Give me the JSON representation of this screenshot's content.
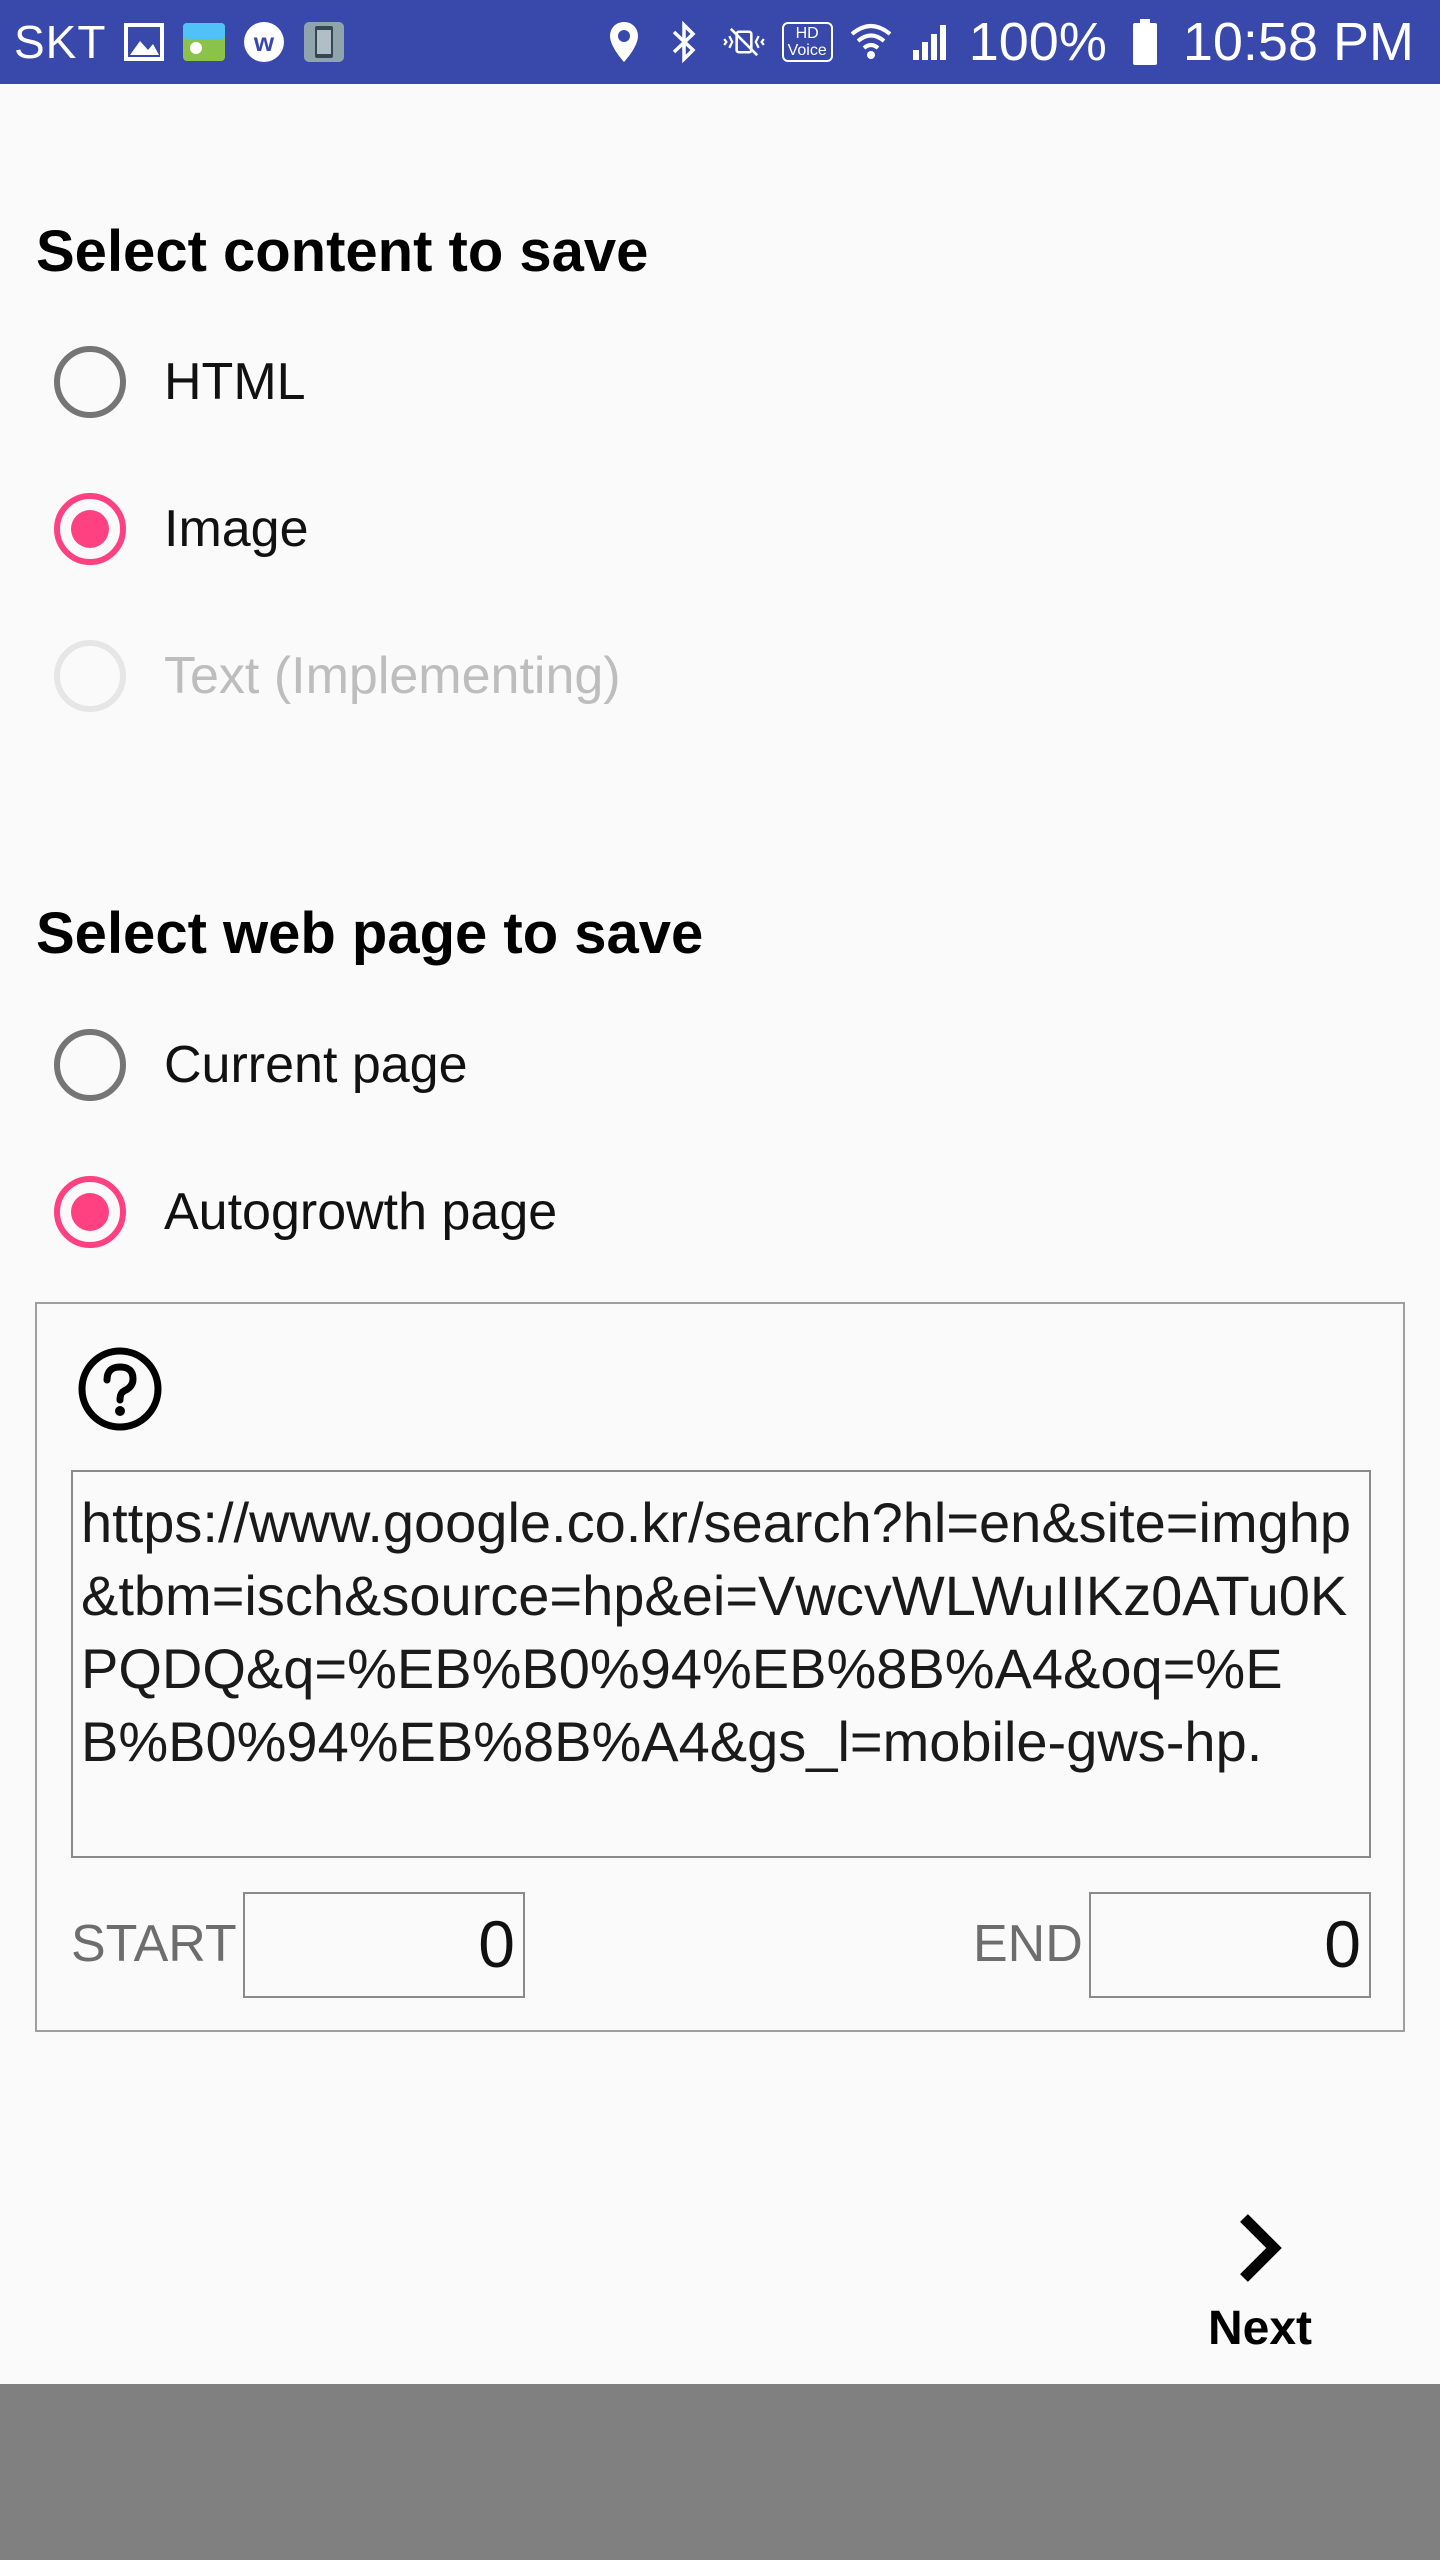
{
  "status_bar": {
    "carrier": "SKT",
    "hd_voice_top": "HD",
    "hd_voice_bottom": "Voice",
    "battery": "100%",
    "time": "10:58 PM",
    "color": "#3949ab"
  },
  "content_section": {
    "title": "Select content to save",
    "options": [
      {
        "label": "HTML",
        "checked": false,
        "enabled": true
      },
      {
        "label": "Image",
        "checked": true,
        "enabled": true
      },
      {
        "label": "Text (Implementing)",
        "checked": false,
        "enabled": false
      }
    ]
  },
  "page_section": {
    "title": "Select web page to save",
    "options": [
      {
        "label": "Current page",
        "checked": false,
        "enabled": true
      },
      {
        "label": "Autogrowth page",
        "checked": true,
        "enabled": true
      }
    ]
  },
  "autogrowth": {
    "help_icon": "question-circle-icon",
    "url": "https://www.google.co.kr/search?hl=en&site=imghp&tbm=isch&source=hp&ei=VwcvWLWuIIKz0ATu0KPQDQ&q=%EB%B0%94%EB%8B%A4&oq=%EB%B0%94%EB%8B%A4&gs_l=mobile-gws-hp.",
    "start_label": "START",
    "start_value": "0",
    "end_label": "END",
    "end_value": "0"
  },
  "footer": {
    "next_label": "Next",
    "next_icon": "chevron-right-icon"
  },
  "colors": {
    "accent": "#ff4081",
    "background": "#fafafa",
    "nav_bar": "#808080"
  }
}
